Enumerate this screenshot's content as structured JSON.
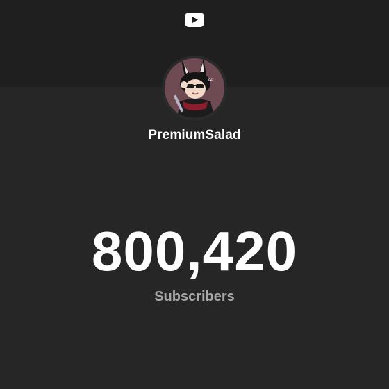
{
  "brand": {
    "icon": "youtube-play-icon",
    "icon_color": "#ffffff"
  },
  "channel": {
    "name": "PremiumSalad",
    "avatar": "channel-avatar-illustration"
  },
  "stats": {
    "subscriber_count": "800,420",
    "subscriber_label": "Subscribers"
  },
  "colors": {
    "background": "#262626",
    "header_band": "#1f1f1f",
    "primary_text": "#ffffff",
    "secondary_text": "#a8a8a8"
  }
}
